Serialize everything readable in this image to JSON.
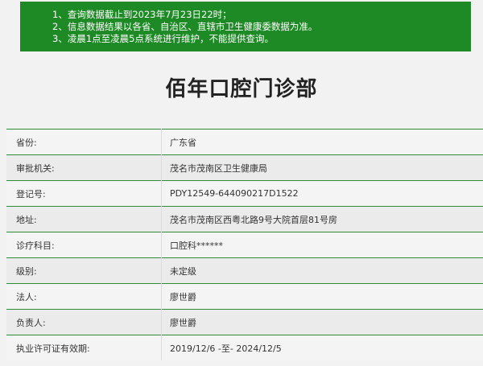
{
  "notice": {
    "lines": [
      "1、查询数据截止到2023年7月23日22时；",
      "2、信息数据结果以各省、自治区、直辖市卫生健康委数据为准。",
      "3、凌晨1点至凌晨5点系统进行维护，不能提供查询。"
    ]
  },
  "page_title": "佰年口腔门诊部",
  "rows": [
    {
      "label": "省份:",
      "value": "广东省"
    },
    {
      "label": "审批机关:",
      "value": "茂名市茂南区卫生健康局"
    },
    {
      "label": "登记号:",
      "value": "PDY12549-644090217D1522"
    },
    {
      "label": "地址:",
      "value": "茂名市茂南区西粤北路9号大院首层81号房"
    },
    {
      "label": "诊疗科目:",
      "value": "口腔科******"
    },
    {
      "label": "级别:",
      "value": "未定级"
    },
    {
      "label": "法人:",
      "value": "廖世爵"
    },
    {
      "label": "负责人:",
      "value": "廖世爵"
    },
    {
      "label": "执业许可证有效期:",
      "value": "2019/12/6 -至- 2024/12/5"
    }
  ],
  "colors": {
    "notice_bg": "#1e8a25",
    "row_divider": "#2e8b36"
  }
}
